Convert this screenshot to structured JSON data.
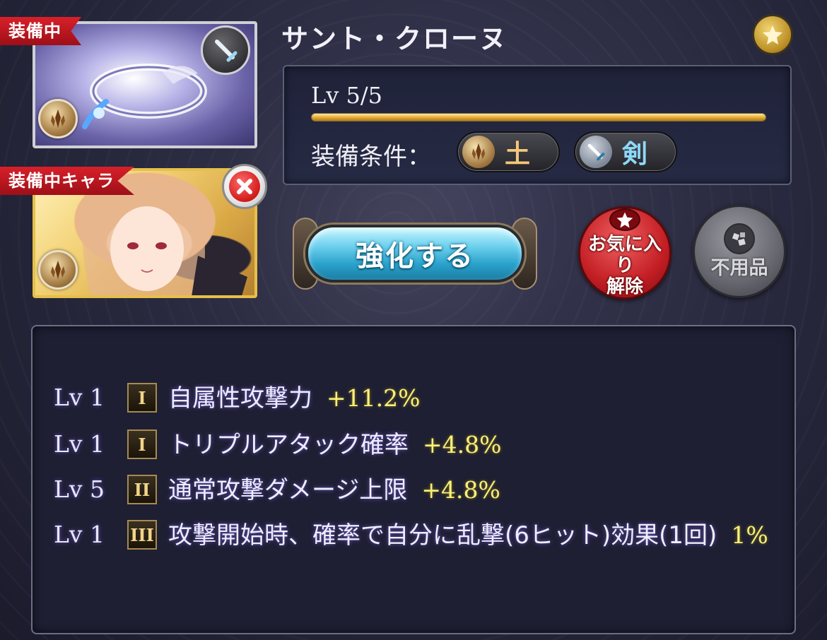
{
  "weapon": {
    "equipped_tag": "装備中",
    "name": "サント・クローヌ",
    "element_icon": "earth-element-icon",
    "type_icon": "sword-icon"
  },
  "character": {
    "tag": "装備中キャラ",
    "element_icon": "earth-element-icon",
    "remove_icon": "close-icon"
  },
  "favorite_icon": "star-icon",
  "level": {
    "text": "Lv 5/5",
    "progress": 1.0,
    "bar_color": "#e0a42a"
  },
  "requirements": {
    "label": "装備条件：",
    "element": {
      "icon": "earth-element-icon",
      "label": "土"
    },
    "weapon_type": {
      "icon": "sword-icon",
      "label": "剣"
    }
  },
  "actions": {
    "upgrade_label": "強化する",
    "unfavorite_line1": "お気に入り",
    "unfavorite_line2": "解除",
    "junk_label": "不用品"
  },
  "skills": [
    {
      "lv": "Lv 1",
      "tier": "I",
      "name": "自属性攻撃力",
      "value": "+11.2%"
    },
    {
      "lv": "Lv 1",
      "tier": "I",
      "name": "トリプルアタック確率",
      "value": "+4.8%"
    },
    {
      "lv": "Lv 5",
      "tier": "II",
      "name": "通常攻撃ダメージ上限",
      "value": "+4.8%"
    },
    {
      "lv": "Lv 1",
      "tier": "III",
      "name": "攻撃開始時、確率で自分に乱撃(6ヒット)効果(1回)",
      "value": "1%"
    }
  ],
  "colors": {
    "accent_gold": "#f8f07a",
    "tag_red": "#d8202a",
    "upgrade_cyan": "#6fd2ee"
  }
}
